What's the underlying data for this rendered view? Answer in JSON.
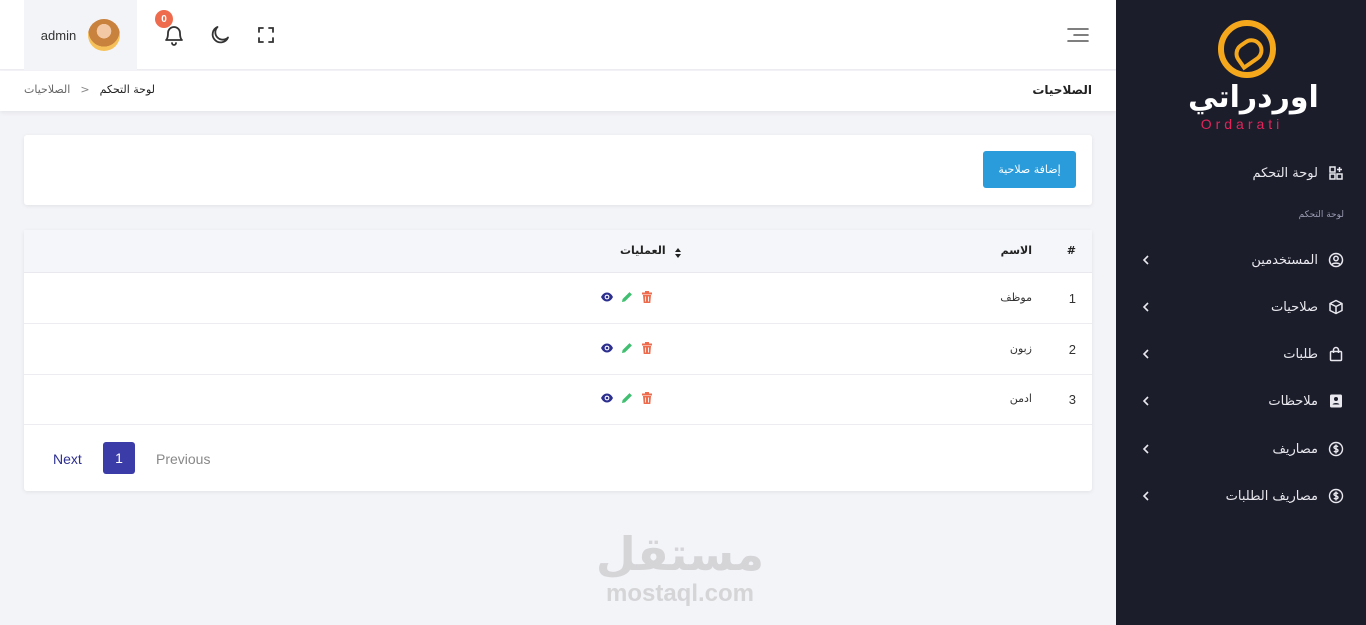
{
  "sidebar": {
    "brand_ar": "اوردراتي",
    "brand_en": "Ordarati",
    "dashboard": "لوحة التحكم",
    "caption": "لوحة التحكم",
    "items": [
      {
        "label": "المستخدمين",
        "icon": "user-circle-icon"
      },
      {
        "label": "صلاحيات",
        "icon": "cube-icon"
      },
      {
        "label": "طلبات",
        "icon": "shopping-bag-icon"
      },
      {
        "label": "ملاحظات",
        "icon": "contact-book-icon"
      },
      {
        "label": "مصاريف",
        "icon": "dollar-circle-icon"
      },
      {
        "label": "مصاريف الطلبات",
        "icon": "dollar-circle-icon"
      }
    ]
  },
  "header": {
    "username": "admin",
    "notification_count": "0"
  },
  "breadcrumb": {
    "page_title": "الصلاحيات",
    "home": "لوحة التحكم",
    "separator": "<",
    "current": "الصلاحيات"
  },
  "actions": {
    "add_label": "إضافة صلاحية"
  },
  "table": {
    "columns": {
      "hash": "#",
      "name": "الاسم",
      "ops": "العمليات"
    },
    "rows": [
      {
        "num": "1",
        "name": "موظف"
      },
      {
        "num": "2",
        "name": "زبون"
      },
      {
        "num": "3",
        "name": "ادمن"
      }
    ]
  },
  "pagination": {
    "next": "Next",
    "page": "1",
    "previous": "Previous"
  },
  "watermark": {
    "ar": "مستقل",
    "en": "mostaql.com"
  },
  "colors": {
    "sidebar_bg": "#1c1d2b",
    "brand_orange": "#f5a81c",
    "brand_pink": "#e2245a",
    "primary": "#2a9bdb",
    "pager_active": "#3c3ca8",
    "view_icon": "#2d2f8f",
    "edit_icon": "#3fbf6f",
    "delete_icon": "#ee6b4d"
  }
}
